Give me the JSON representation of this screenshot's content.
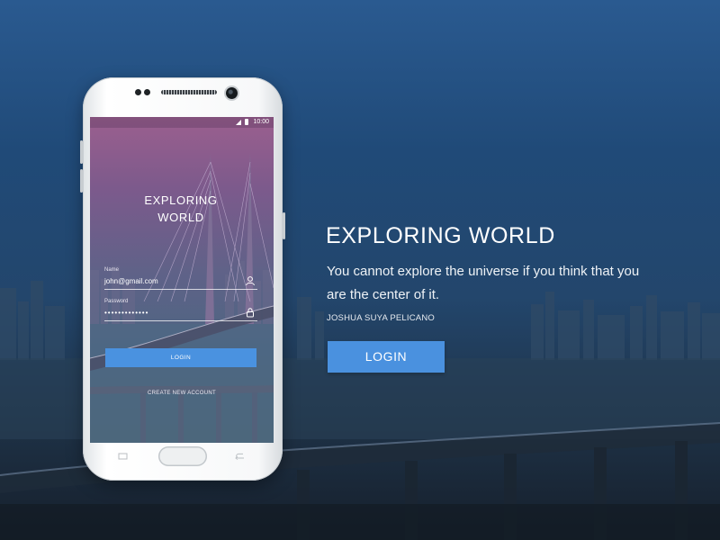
{
  "background": {
    "accent_color": "#4a91df"
  },
  "phone": {
    "status_bar": {
      "time": "10:00"
    },
    "app": {
      "title_line1": "EXPLORING",
      "title_line2": "WORLD",
      "name_label": "Name",
      "name_value": "john@gmail.com",
      "password_label": "Password",
      "password_value": "•••••••••••••",
      "login_label": "LOGIN",
      "create_account_label": "CREATE NEW ACCOUNT",
      "icons": [
        "user-icon",
        "lock-icon"
      ]
    }
  },
  "hero": {
    "title": "EXPLORING WORLD",
    "tagline": "You cannot explore the universe if you think that you are the center of it.",
    "author": "JOSHUA SUYA PELICANO",
    "login_label": "LOGIN"
  }
}
